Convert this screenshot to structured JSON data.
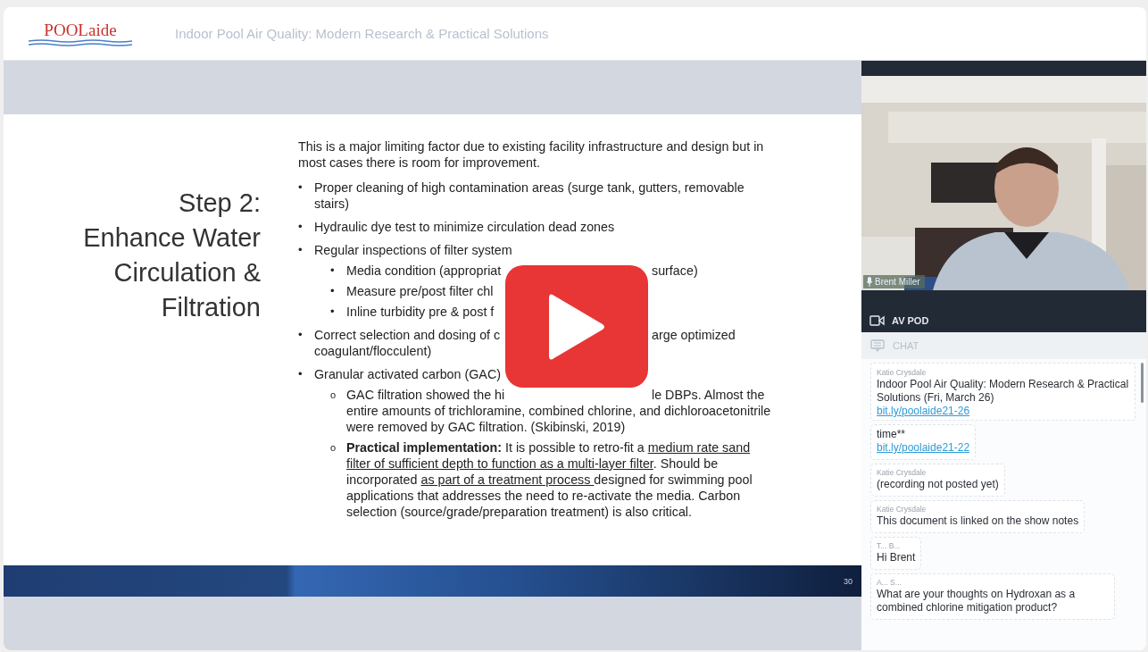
{
  "header": {
    "logo": "POOLaide",
    "title": "Indoor Pool Air Quality: Modern Research & Practical Solutions"
  },
  "slide": {
    "title_lines": [
      "Step 2:",
      "Enhance Water",
      "Circulation &",
      "Filtration"
    ],
    "intro": "This is a major limiting factor due to existing facility infrastructure and design but in most cases there is room for improvement.",
    "items": [
      {
        "marker": "•",
        "text": "Proper cleaning of high contamination areas (surge tank, gutters, removable stairs)"
      },
      {
        "marker": "•",
        "text": "Hydraulic dye test to minimize circulation dead zones"
      },
      {
        "marker": "•",
        "text": "Regular inspections of filter system",
        "children": [
          {
            "marker": "•",
            "text": "Media condition (appropriat",
            "after": "surface)"
          },
          {
            "marker": "•",
            "text": "Measure pre/post filter chl"
          },
          {
            "marker": "•",
            "text": "Inline turbidity pre & post f"
          }
        ]
      },
      {
        "marker": "•",
        "text": "Correct selection and dosing of c",
        "after": "arge optimized",
        "continuation": "coagulant/flocculent)"
      },
      {
        "marker": "•",
        "text": "Granular activated carbon (GAC)",
        "children": [
          {
            "marker": "o",
            "text": "GAC filtration showed the hi",
            "after": "le DBPs. Almost the",
            "continuation": "entire amounts of trichloramine, combined chlorine, and dichloroacetonitrile were removed by GAC filtration. (Skibinski, 2019)"
          },
          {
            "marker": "o",
            "segments": [
              {
                "kind": "bold",
                "text": "Practical implementation:"
              },
              {
                "kind": "plain",
                "text": " It is possible to retro-fit a "
              },
              {
                "kind": "underline",
                "text": "medium rate sand filter of sufficient depth to function as a multi-layer filter"
              },
              {
                "kind": "plain",
                "text": ".  Should be incorporated "
              },
              {
                "kind": "underline",
                "text": "as part of a treatment process "
              },
              {
                "kind": "plain",
                "text": "designed for swimming pool applications that addresses the need to re-activate the media.  Carbon selection (source/grade/preparation treatment) is also critical."
              }
            ]
          }
        ]
      }
    ],
    "page_number": "30"
  },
  "video": {
    "kind": "picture",
    "participant": "Brent Miller"
  },
  "av_pod": {
    "label": "AV POD"
  },
  "chat": {
    "label": "CHAT",
    "pinned": {
      "author": "Katie Crysdale",
      "text": "Indoor Pool Air Quality: Modern Research & Practical Solutions (Fri, March 26)",
      "link": "bit.ly/poolaide21-26"
    },
    "messages": [
      {
        "text": "time**",
        "link": "bit.ly/poolaide21-22"
      },
      {
        "author": "Katie Crysdale",
        "text": "(recording not posted yet)"
      },
      {
        "author": "Katie Crysdale",
        "text": "This document is linked on the show notes"
      },
      {
        "author": "T... B...",
        "text": "Hi Brent"
      },
      {
        "author": "A... S...",
        "text": "What are your thoughts on Hydroxan as a combined chlorine mitigation product?"
      }
    ]
  }
}
